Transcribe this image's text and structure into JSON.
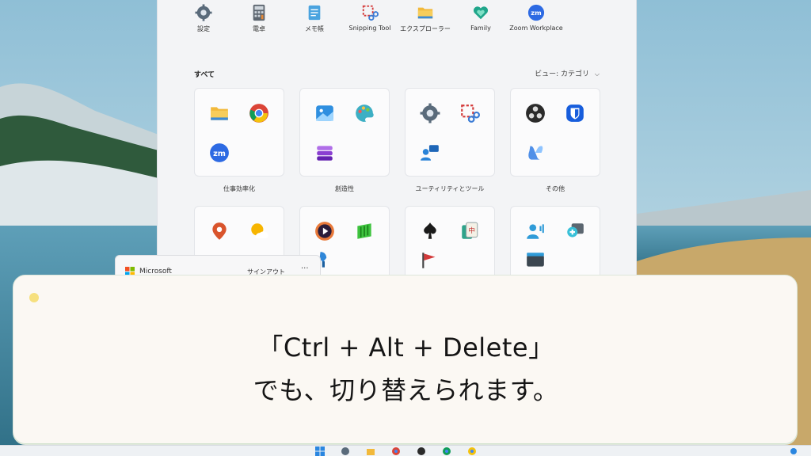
{
  "pinned_apps": [
    {
      "label": "設定",
      "icon": "gear-icon"
    },
    {
      "label": "電卓",
      "icon": "calculator-icon"
    },
    {
      "label": "メモ帳",
      "icon": "notepad-icon"
    },
    {
      "label": "Snipping Tool",
      "icon": "snipping-tool-icon"
    },
    {
      "label": "エクスプローラー",
      "icon": "folder-icon"
    },
    {
      "label": "Family",
      "icon": "family-heart-icon"
    },
    {
      "label": "Zoom Workplace",
      "icon": "zoom-icon"
    }
  ],
  "all_apps": {
    "title": "すべて",
    "view_label": "ビュー: カテゴリ",
    "categories": [
      {
        "label": "仕事効率化",
        "icons": [
          "folder-icon",
          "chrome-icon",
          "zoom-icon"
        ]
      },
      {
        "label": "創造性",
        "icons": [
          "photos-icon",
          "paint-icon",
          "clipchamp-icon"
        ]
      },
      {
        "label": "ユーティリティとツール",
        "icons": [
          "gear-icon",
          "snipping-tool-icon",
          "quick-assist-icon"
        ]
      },
      {
        "label": "その他",
        "icons": [
          "obs-icon",
          "bitwarden-icon",
          "copilot-icon"
        ]
      },
      {
        "label": "",
        "icons": [
          "maps-icon",
          "weather-icon"
        ]
      },
      {
        "label": "",
        "icons": [
          "media-player-icon",
          "green-app-icon",
          "paint-3d-icon"
        ]
      },
      {
        "label": "",
        "icons": [
          "solitaire-icon",
          "mahjong-icon",
          "game-flag-icon"
        ]
      },
      {
        "label": "",
        "icons": [
          "people-icon",
          "magnifier-icon",
          "keyboard-icon"
        ]
      }
    ]
  },
  "account": {
    "name": "Microsoft",
    "signout": "サインアウト",
    "more": "···"
  },
  "caption": {
    "line1": "「Ctrl + Alt + Delete」",
    "line2": "でも、切り替えられます。"
  },
  "colors": {
    "caption_bg": "#fbf8f3",
    "caption_dot": "#f6e07e",
    "start_menu_bg": "#f3f4f6"
  }
}
